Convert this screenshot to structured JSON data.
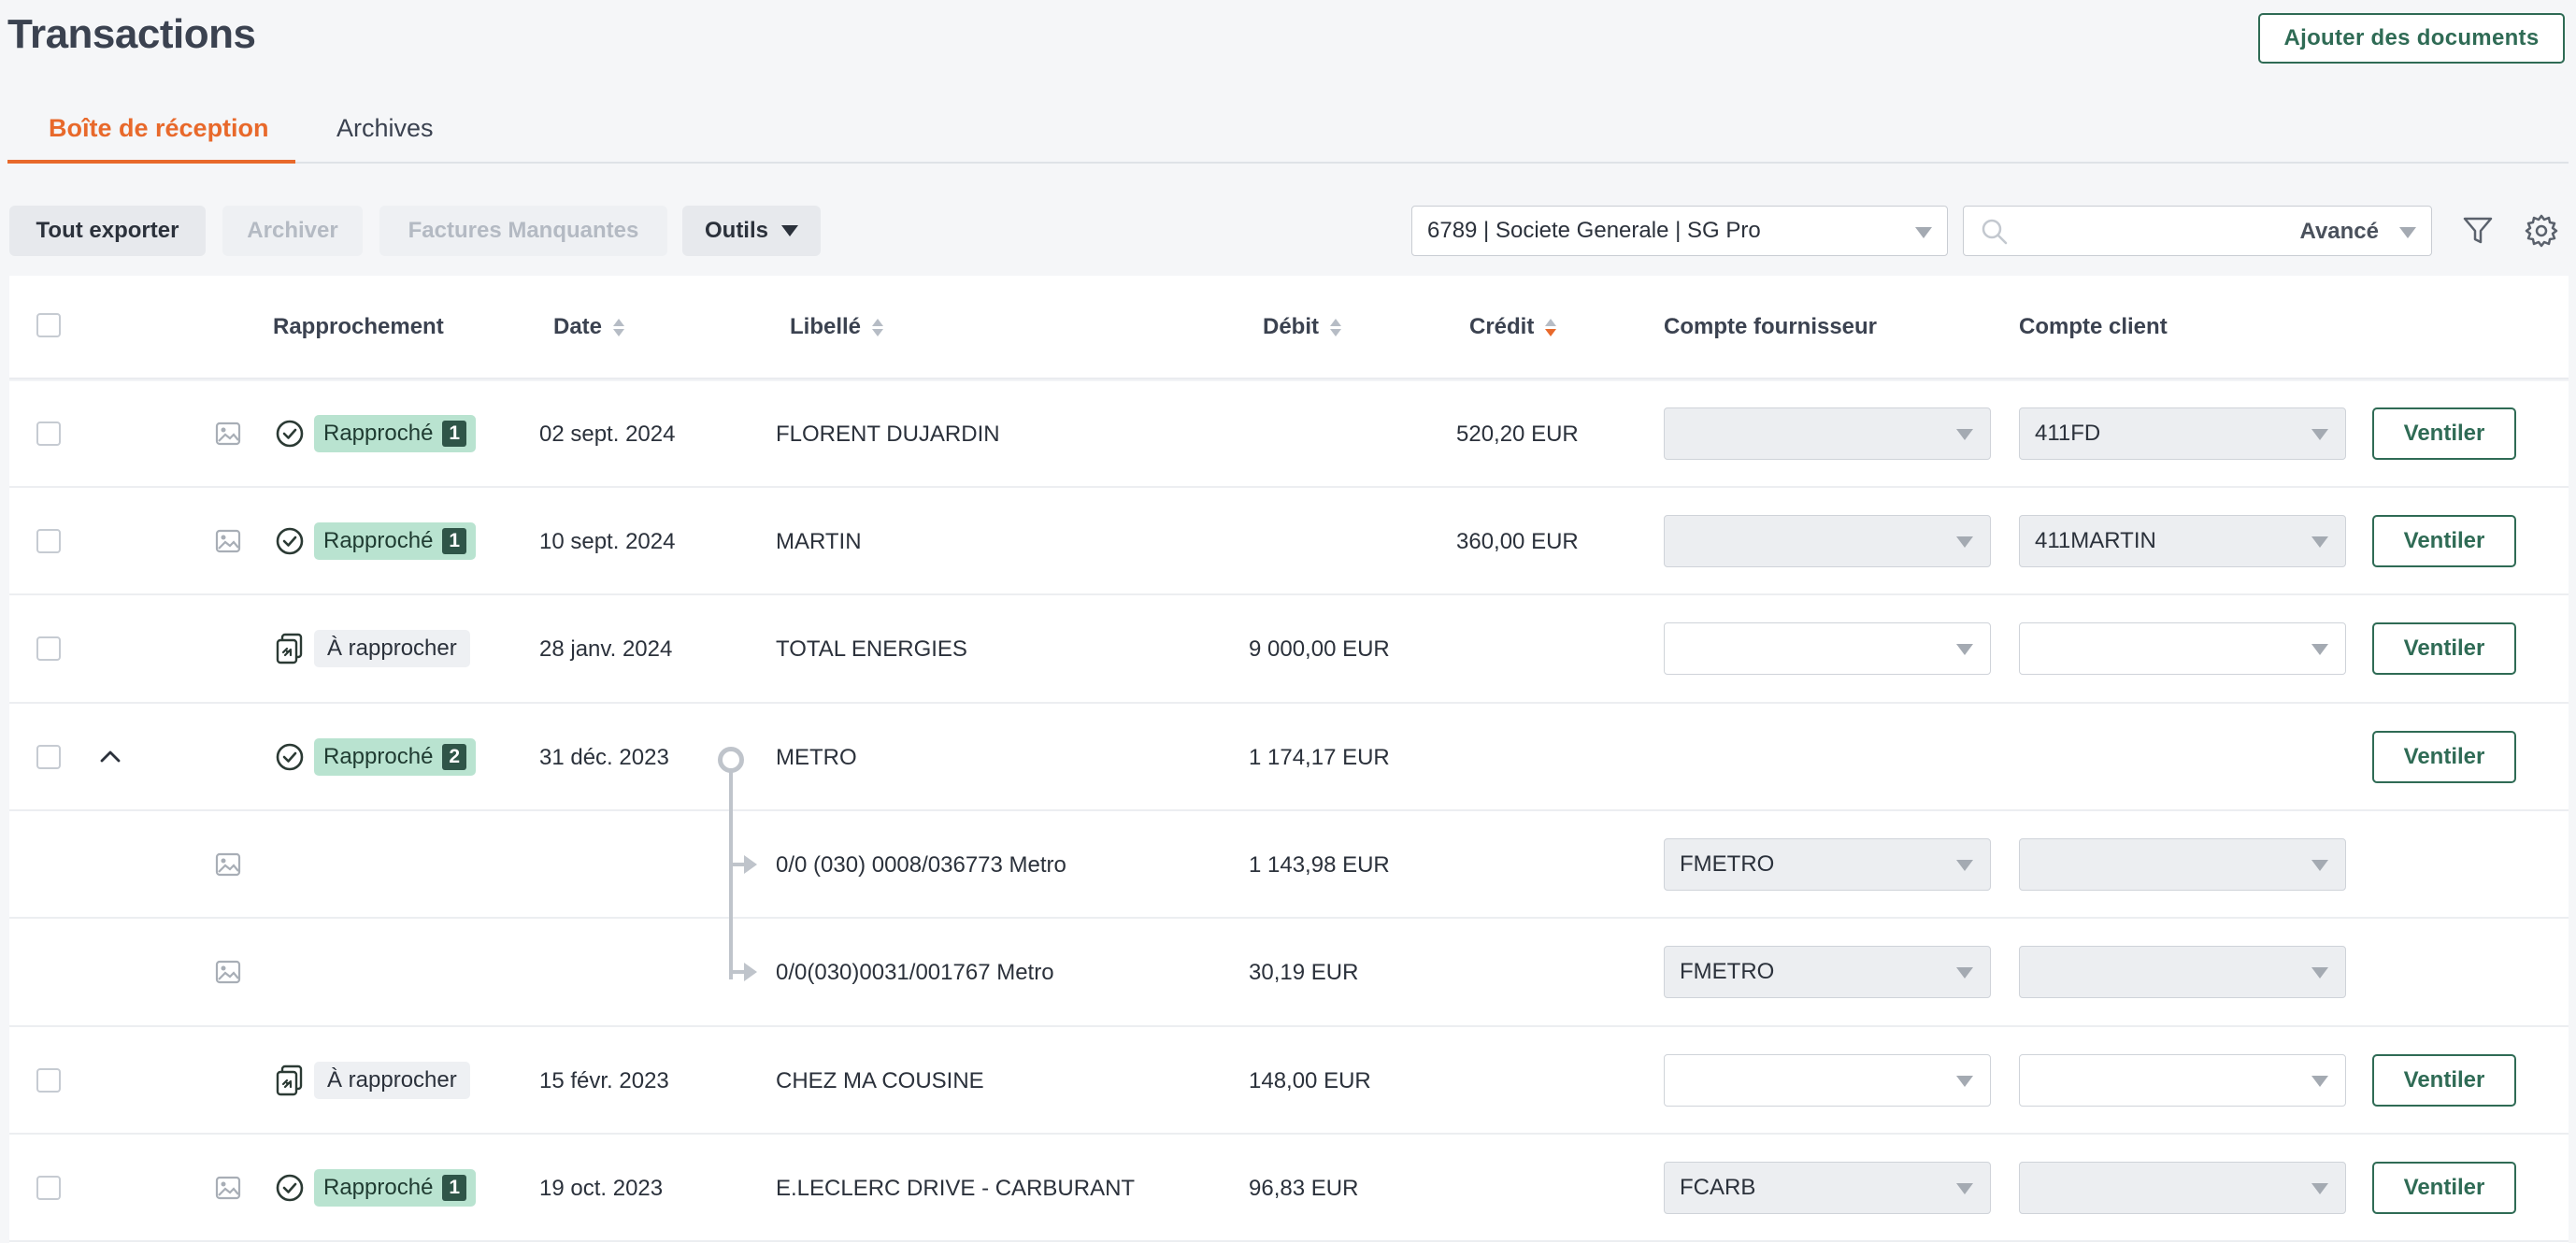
{
  "page": {
    "title": "Transactions",
    "add_documents_label": "Ajouter des documents"
  },
  "tabs": [
    {
      "label": "Boîte de réception",
      "active": true
    },
    {
      "label": "Archives",
      "active": false
    }
  ],
  "toolbar": {
    "export_label": "Tout exporter",
    "archive_label": "Archiver",
    "missing_invoices_label": "Factures Manquantes",
    "tools_label": "Outils",
    "bank_account": "6789 | Societe Generale | SG Pro",
    "search_placeholder": "",
    "advanced_label": "Avancé"
  },
  "colors": {
    "accent": "#e8692b",
    "primary": "#2f6b55",
    "badge_ok": "#b9e3d0",
    "badge_num": "#2f5548"
  },
  "table": {
    "columns": {
      "reconciliation": "Rapprochement",
      "date": "Date",
      "label": "Libellé",
      "debit": "Débit",
      "credit": "Crédit",
      "supplier_account": "Compte fournisseur",
      "client_account": "Compte client"
    },
    "sort_active": "Crédit",
    "action_label": "Ventiler",
    "rows": [
      {
        "status": "Rapproché",
        "count": "1",
        "date": "02 sept. 2024",
        "label": "FLORENT DUJARDIN",
        "debit": "",
        "credit": "520,20 EUR",
        "supplier": "",
        "client": "411FD"
      },
      {
        "status": "Rapproché",
        "count": "1",
        "date": "10 sept. 2024",
        "label": "MARTIN",
        "debit": "",
        "credit": "360,00 EUR",
        "supplier": "",
        "client": "411MARTIN"
      },
      {
        "status": "À rapprocher",
        "count": "",
        "date": "28 janv. 2024",
        "label": "TOTAL ENERGIES",
        "debit": "9 000,00 EUR",
        "credit": "",
        "supplier": "",
        "client": ""
      },
      {
        "status": "Rapproché",
        "count": "2",
        "date": "31 déc. 2023",
        "label": "METRO",
        "debit": "1 174,17 EUR",
        "credit": "",
        "expanded": true
      },
      {
        "sub": true,
        "label": "0/0 (030) 0008/036773 Metro",
        "debit": "1 143,98 EUR",
        "supplier": "FMETRO",
        "client": ""
      },
      {
        "sub": true,
        "label": "0/0(030)0031/001767 Metro",
        "debit": "30,19 EUR",
        "supplier": "FMETRO",
        "client": ""
      },
      {
        "status": "À rapprocher",
        "count": "",
        "date": "15 févr. 2023",
        "label": "CHEZ MA COUSINE",
        "debit": "148,00 EUR",
        "credit": "",
        "supplier": "",
        "client": ""
      },
      {
        "status": "Rapproché",
        "count": "1",
        "date": "19 oct. 2023",
        "label": "E.LECLERC DRIVE - CARBURANT",
        "debit": "96,83 EUR",
        "credit": "",
        "supplier": "FCARB",
        "client": ""
      }
    ]
  }
}
